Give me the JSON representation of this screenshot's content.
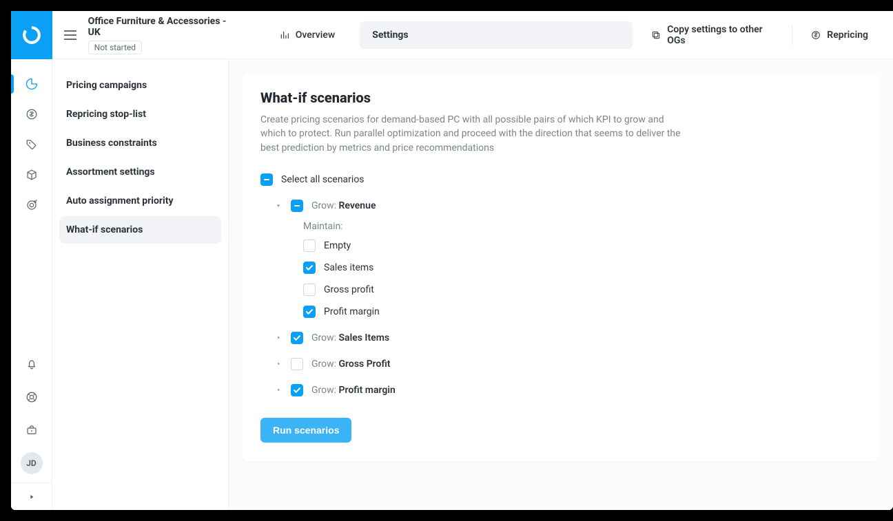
{
  "header": {
    "title": "Office Furniture & Accessories - UK",
    "status": "Not started",
    "tabs": {
      "overview": "Overview",
      "settings": "Settings"
    },
    "copy_action": "Copy settings to other OGs",
    "repricing_action": "Repricing"
  },
  "avatar": {
    "initials": "JD"
  },
  "subnav": {
    "items": [
      "Pricing campaigns",
      "Repricing stop-list",
      "Business constraints",
      "Assortment settings",
      "Auto assignment priority",
      "What-if scenarios"
    ],
    "active_index": 5
  },
  "panel": {
    "title": "What-if scenarios",
    "description": "Create pricing scenarios for demand-based PC with all possible pairs of which KPI to grow and which to protect. Run parallel optimization and proceed with the direction that seems to deliver the best prediction by metrics and price recommendations",
    "select_all": "Select all scenarios",
    "grow_prefix": "Grow: ",
    "maintain_label": "Maintain:",
    "groups": [
      {
        "name": "Revenue",
        "state": "indeterminate",
        "expanded": true,
        "maintain": [
          {
            "label": "Empty",
            "checked": false
          },
          {
            "label": "Sales items",
            "checked": true
          },
          {
            "label": "Gross profit",
            "checked": false
          },
          {
            "label": "Profit margin",
            "checked": true
          }
        ]
      },
      {
        "name": "Sales Items",
        "state": "checked",
        "expanded": false
      },
      {
        "name": "Gross Profit",
        "state": "unchecked",
        "expanded": false
      },
      {
        "name": "Profit margin",
        "state": "checked",
        "expanded": false
      }
    ],
    "run_button": "Run scenarios"
  }
}
